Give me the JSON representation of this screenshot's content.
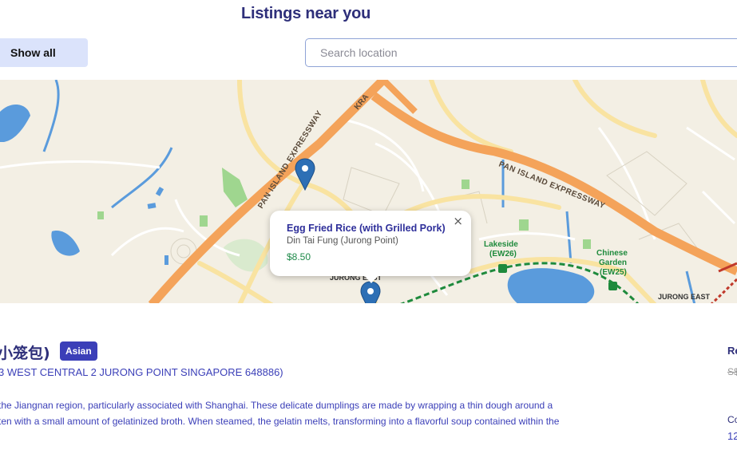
{
  "header": {
    "title": "Listings near you"
  },
  "controls": {
    "show_all_label": "Show all",
    "search_placeholder": "Search location"
  },
  "map": {
    "road_labels": [
      "PAN ISLAND EXPRESSWAY",
      "PAN ISLAND EXPRESSWAY",
      "KRA"
    ],
    "place_labels": [
      "JURONG EAST",
      "JURONG EAST"
    ],
    "stations": [
      {
        "name": "Lakeside",
        "code": "(EW26)"
      },
      {
        "name": "Chinese",
        "name2": "Garden",
        "code": "(EW25)"
      }
    ],
    "popup": {
      "title": "Egg Fried Rice (with Grilled Pork)",
      "restaurant": "Din Tai Fung (Jurong Point)",
      "price": "$8.50",
      "close": "×"
    }
  },
  "listing": {
    "name": "小笼包)",
    "tag": "Asian",
    "address": "3 WEST CENTRAL 2 JURONG POINT SINGAPORE 648886)",
    "description": [
      "the Jiangnan region, particularly associated with Shanghai. These delicate dumplings are made by wrapping a thin dough around a",
      "ten with a small amount of gelatinized broth. When steamed, the gelatin melts, transforming into a flavorful soup contained within the"
    ],
    "right_labels": [
      "Re",
      "S$",
      "Co",
      "12"
    ]
  },
  "colors": {
    "accent": "#3b3fb8",
    "title": "#2e2f7a",
    "price": "#1f8a4a",
    "expressway": "#f4a35a",
    "water": "#5a9bdc",
    "mrt": "#1e8a3c"
  }
}
